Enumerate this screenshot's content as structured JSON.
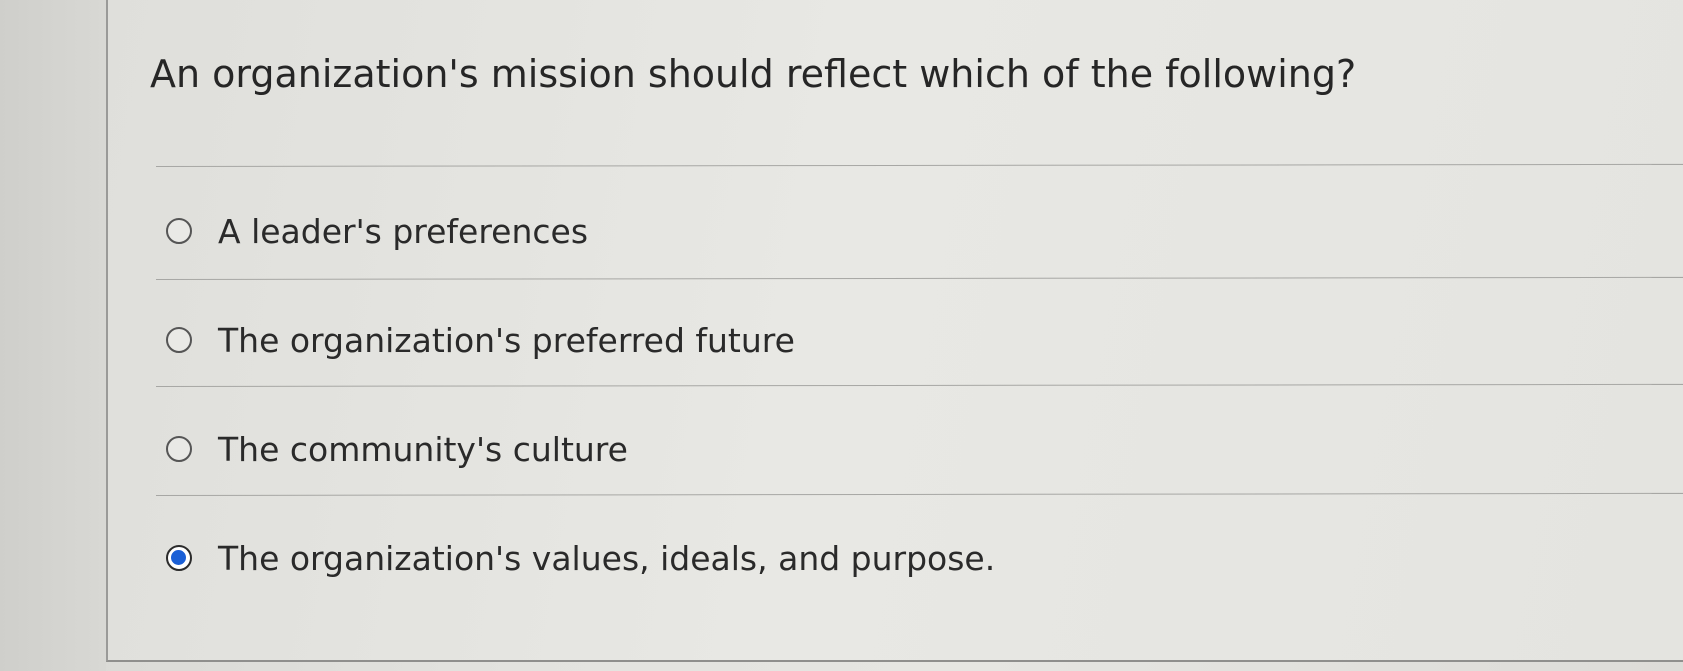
{
  "question": {
    "text": "An organization's mission should reflect which of the following?"
  },
  "options": [
    {
      "label": "A leader's preferences",
      "selected": false
    },
    {
      "label": "The organization's preferred future",
      "selected": false
    },
    {
      "label": "The community's culture",
      "selected": false
    },
    {
      "label": "The organization's values, ideals, and purpose.",
      "selected": true
    }
  ],
  "colors": {
    "selected_radio": "#1a5fd6",
    "text": "#262626"
  }
}
